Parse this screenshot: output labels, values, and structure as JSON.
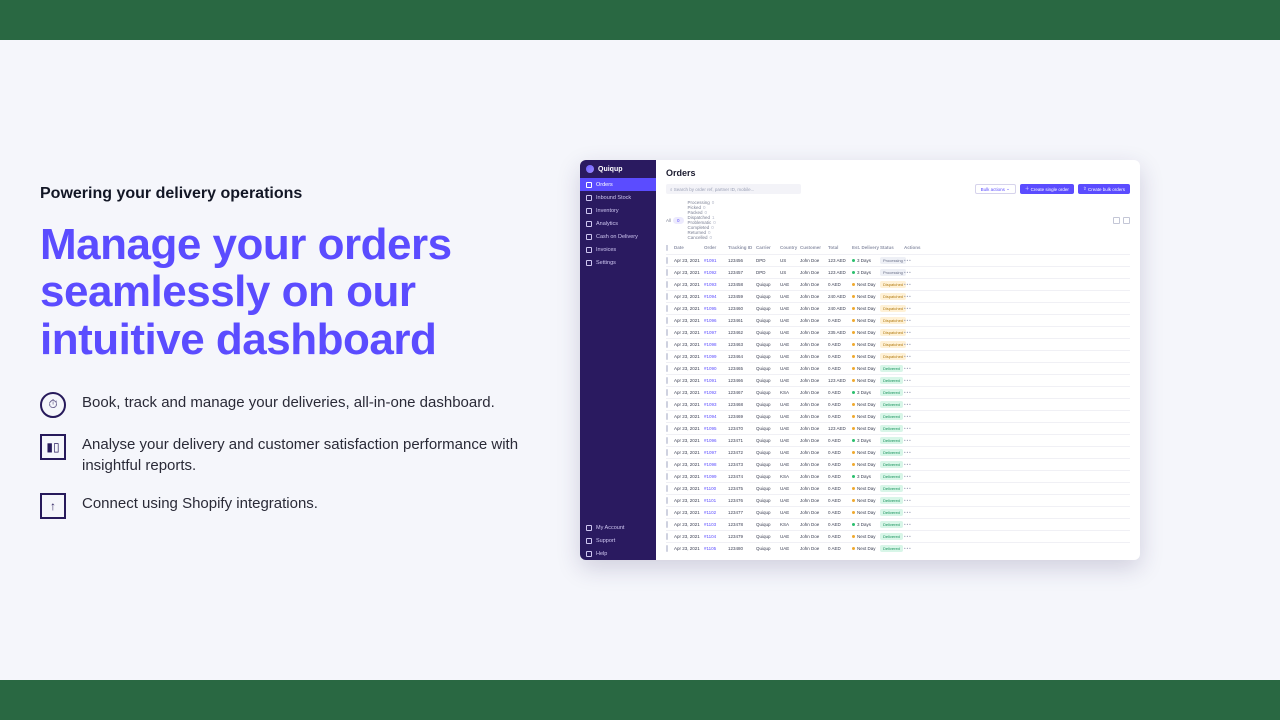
{
  "marketing": {
    "kicker": "Powering your delivery operations",
    "hero": "Manage your orders seamlessly on our intuitive dashboard",
    "features": [
      "Book, track and manage your deliveries, all-in-one dashboard.",
      "Analyse your delivery and customer satisfaction performance with insightful reports.",
      "Connect using Shopify integrations."
    ]
  },
  "app": {
    "brand": "Quiqup",
    "nav": [
      "Orders",
      "Inbound Stock",
      "Inventory",
      "Analytics",
      "Cash on Delivery",
      "Invoices",
      "Settings"
    ],
    "navBottom": [
      "My Account",
      "Support",
      "Help"
    ],
    "title": "Orders",
    "searchPlaceholder": "Search by order ref, partner ID, mobile...",
    "bulk": "Bulk actions",
    "createSingle": "Create single order",
    "createBulk": "Create bulk orders",
    "filterAll": "All",
    "filterAllCount": "0",
    "filters": [
      {
        "label": "Processing",
        "n": "0"
      },
      {
        "label": "Picked",
        "n": "0"
      },
      {
        "label": "Packed",
        "n": "0"
      },
      {
        "label": "Dispatched",
        "n": "1"
      },
      {
        "label": "Problematic",
        "n": "0"
      },
      {
        "label": "Completed",
        "n": "0"
      },
      {
        "label": "Returned",
        "n": "0"
      },
      {
        "label": "Cancelled",
        "n": "0"
      }
    ],
    "cols": [
      "",
      "Date",
      "Order",
      "Tracking ID",
      "Carrier",
      "Country",
      "Customer",
      "Total",
      "Est. Delivery",
      "Status",
      "Actions"
    ],
    "rows": [
      {
        "date": "Apr 23, 2021",
        "order": "#1091",
        "tid": "123456",
        "car": "DPD",
        "ctry": "US",
        "cust": "John Doe",
        "tot": "123 AED",
        "ed": "3 Days",
        "edc": "eg",
        "st": "Processing",
        "sc": "sP"
      },
      {
        "date": "Apr 23, 2021",
        "order": "#1092",
        "tid": "123457",
        "car": "DPD",
        "ctry": "US",
        "cust": "John Doe",
        "tot": "123 AED",
        "ed": "3 Days",
        "edc": "eg",
        "st": "Processing",
        "sc": "sP"
      },
      {
        "date": "Apr 23, 2021",
        "order": "#1093",
        "tid": "123458",
        "car": "Quiqup",
        "ctry": "UAE",
        "cust": "John Doe",
        "tot": "0 AED",
        "ed": "Next Day",
        "edc": "eo",
        "st": "Dispatched",
        "sc": "sD"
      },
      {
        "date": "Apr 23, 2021",
        "order": "#1094",
        "tid": "123459",
        "car": "Quiqup",
        "ctry": "UAE",
        "cust": "John Doe",
        "tot": "240 AED",
        "ed": "Next Day",
        "edc": "eo",
        "st": "Dispatched",
        "sc": "sD"
      },
      {
        "date": "Apr 23, 2021",
        "order": "#1095",
        "tid": "123460",
        "car": "Quiqup",
        "ctry": "UAE",
        "cust": "John Doe",
        "tot": "240 AED",
        "ed": "Next Day",
        "edc": "eo",
        "st": "Dispatched",
        "sc": "sD"
      },
      {
        "date": "Apr 23, 2021",
        "order": "#1096",
        "tid": "123461",
        "car": "Quiqup",
        "ctry": "UAE",
        "cust": "John Doe",
        "tot": "0 AED",
        "ed": "Next Day",
        "edc": "eo",
        "st": "Dispatched",
        "sc": "sD"
      },
      {
        "date": "Apr 23, 2021",
        "order": "#1097",
        "tid": "123462",
        "car": "Quiqup",
        "ctry": "UAE",
        "cust": "John Doe",
        "tot": "235 AED",
        "ed": "Next Day",
        "edc": "eo",
        "st": "Dispatched",
        "sc": "sD"
      },
      {
        "date": "Apr 23, 2021",
        "order": "#1098",
        "tid": "123463",
        "car": "Quiqup",
        "ctry": "UAE",
        "cust": "John Doe",
        "tot": "0 AED",
        "ed": "Next Day",
        "edc": "eo",
        "st": "Dispatched",
        "sc": "sD"
      },
      {
        "date": "Apr 23, 2021",
        "order": "#1099",
        "tid": "123464",
        "car": "Quiqup",
        "ctry": "UAE",
        "cust": "John Doe",
        "tot": "0 AED",
        "ed": "Next Day",
        "edc": "eo",
        "st": "Dispatched",
        "sc": "sD"
      },
      {
        "date": "Apr 23, 2021",
        "order": "#1090",
        "tid": "123465",
        "car": "Quiqup",
        "ctry": "UAE",
        "cust": "John Doe",
        "tot": "0 AED",
        "ed": "Next Day",
        "edc": "eo",
        "st": "Delivered",
        "sc": "sV"
      },
      {
        "date": "Apr 23, 2021",
        "order": "#1091",
        "tid": "123466",
        "car": "Quiqup",
        "ctry": "UAE",
        "cust": "John Doe",
        "tot": "123 AED",
        "ed": "Next Day",
        "edc": "eo",
        "st": "Delivered",
        "sc": "sV"
      },
      {
        "date": "Apr 23, 2021",
        "order": "#1092",
        "tid": "123467",
        "car": "Quiqup",
        "ctry": "KSA",
        "cust": "John Doe",
        "tot": "0 AED",
        "ed": "3 Days",
        "edc": "eg",
        "st": "Delivered",
        "sc": "sV"
      },
      {
        "date": "Apr 23, 2021",
        "order": "#1093",
        "tid": "123468",
        "car": "Quiqup",
        "ctry": "UAE",
        "cust": "John Doe",
        "tot": "0 AED",
        "ed": "Next Day",
        "edc": "eo",
        "st": "Delivered",
        "sc": "sV"
      },
      {
        "date": "Apr 23, 2021",
        "order": "#1094",
        "tid": "123469",
        "car": "Quiqup",
        "ctry": "UAE",
        "cust": "John Doe",
        "tot": "0 AED",
        "ed": "Next Day",
        "edc": "eo",
        "st": "Delivered",
        "sc": "sV"
      },
      {
        "date": "Apr 23, 2021",
        "order": "#1095",
        "tid": "123470",
        "car": "Quiqup",
        "ctry": "UAE",
        "cust": "John Doe",
        "tot": "123 AED",
        "ed": "Next Day",
        "edc": "eo",
        "st": "Delivered",
        "sc": "sV"
      },
      {
        "date": "Apr 23, 2021",
        "order": "#1096",
        "tid": "123471",
        "car": "Quiqup",
        "ctry": "UAE",
        "cust": "John Doe",
        "tot": "0 AED",
        "ed": "3 Days",
        "edc": "eg",
        "st": "Delivered",
        "sc": "sV"
      },
      {
        "date": "Apr 23, 2021",
        "order": "#1097",
        "tid": "123472",
        "car": "Quiqup",
        "ctry": "UAE",
        "cust": "John Doe",
        "tot": "0 AED",
        "ed": "Next Day",
        "edc": "eo",
        "st": "Delivered",
        "sc": "sV"
      },
      {
        "date": "Apr 23, 2021",
        "order": "#1098",
        "tid": "123473",
        "car": "Quiqup",
        "ctry": "UAE",
        "cust": "John Doe",
        "tot": "0 AED",
        "ed": "Next Day",
        "edc": "eo",
        "st": "Delivered",
        "sc": "sV"
      },
      {
        "date": "Apr 23, 2021",
        "order": "#1099",
        "tid": "123474",
        "car": "Quiqup",
        "ctry": "KSA",
        "cust": "John Doe",
        "tot": "0 AED",
        "ed": "3 Days",
        "edc": "eg",
        "st": "Delivered",
        "sc": "sV"
      },
      {
        "date": "Apr 23, 2021",
        "order": "#1100",
        "tid": "123475",
        "car": "Quiqup",
        "ctry": "UAE",
        "cust": "John Doe",
        "tot": "0 AED",
        "ed": "Next Day",
        "edc": "eo",
        "st": "Delivered",
        "sc": "sV"
      },
      {
        "date": "Apr 23, 2021",
        "order": "#1101",
        "tid": "123476",
        "car": "Quiqup",
        "ctry": "UAE",
        "cust": "John Doe",
        "tot": "0 AED",
        "ed": "Next Day",
        "edc": "eo",
        "st": "Delivered",
        "sc": "sV"
      },
      {
        "date": "Apr 23, 2021",
        "order": "#1102",
        "tid": "123477",
        "car": "Quiqup",
        "ctry": "UAE",
        "cust": "John Doe",
        "tot": "0 AED",
        "ed": "Next Day",
        "edc": "eo",
        "st": "Delivered",
        "sc": "sV"
      },
      {
        "date": "Apr 23, 2021",
        "order": "#1103",
        "tid": "123478",
        "car": "Quiqup",
        "ctry": "KSA",
        "cust": "John Doe",
        "tot": "0 AED",
        "ed": "3 Days",
        "edc": "eg",
        "st": "Delivered",
        "sc": "sV"
      },
      {
        "date": "Apr 23, 2021",
        "order": "#1104",
        "tid": "123479",
        "car": "Quiqup",
        "ctry": "UAE",
        "cust": "John Doe",
        "tot": "0 AED",
        "ed": "Next Day",
        "edc": "eo",
        "st": "Delivered",
        "sc": "sV"
      },
      {
        "date": "Apr 23, 2021",
        "order": "#1105",
        "tid": "123480",
        "car": "Quiqup",
        "ctry": "UAE",
        "cust": "John Doe",
        "tot": "0 AED",
        "ed": "Next Day",
        "edc": "eo",
        "st": "Delivered",
        "sc": "sV"
      }
    ]
  }
}
